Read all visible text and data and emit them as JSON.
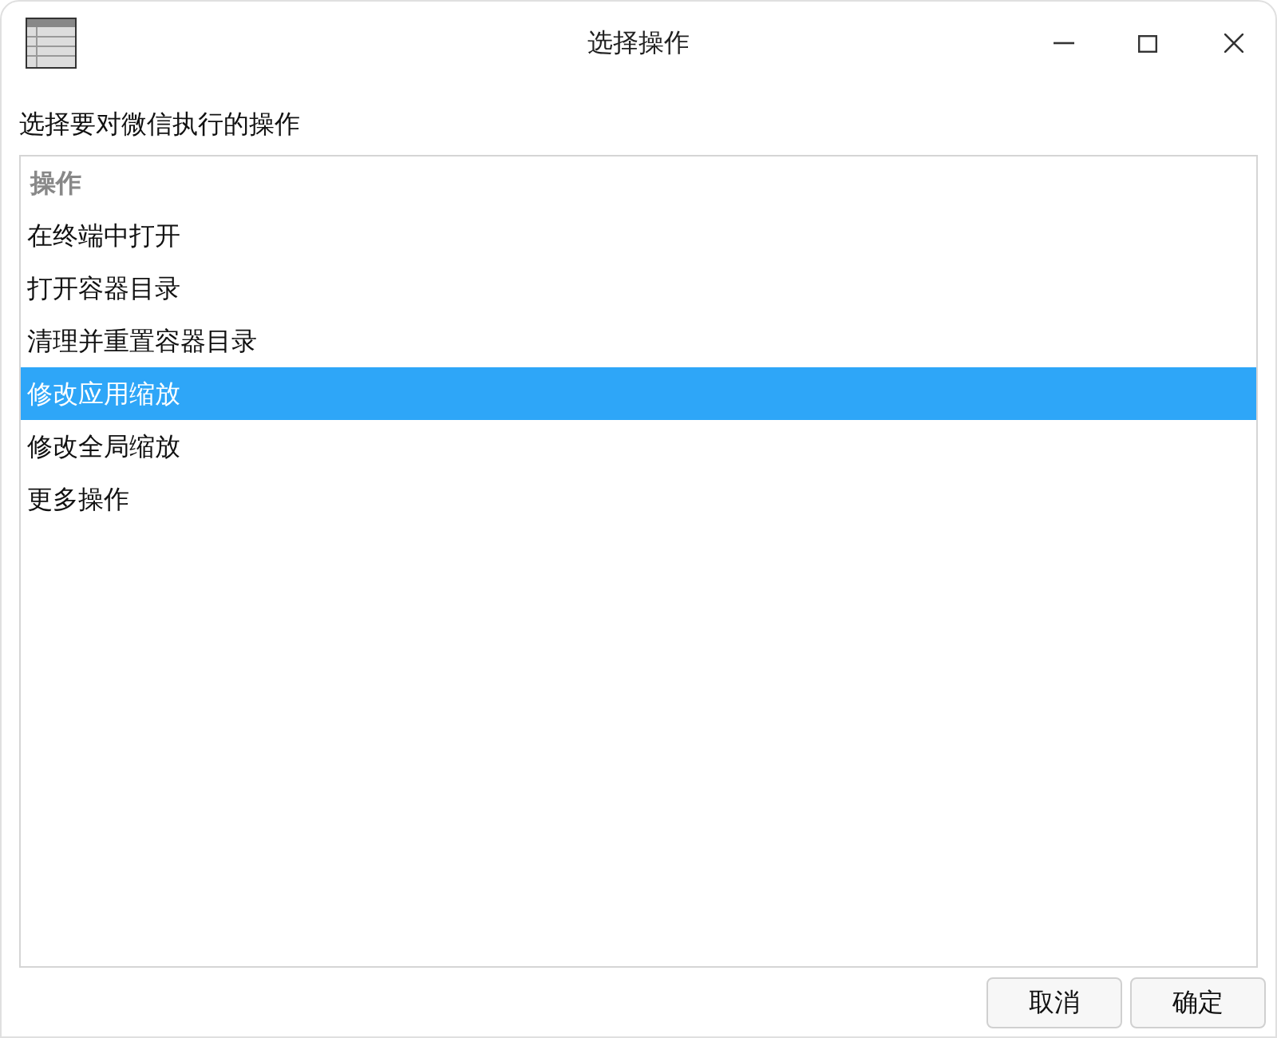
{
  "window": {
    "title": "选择操作"
  },
  "prompt": "选择要对微信执行的操作",
  "list": {
    "header": "操作",
    "items": [
      {
        "label": "在终端中打开",
        "selected": false
      },
      {
        "label": "打开容器目录",
        "selected": false
      },
      {
        "label": "清理并重置容器目录",
        "selected": false
      },
      {
        "label": "修改应用缩放",
        "selected": true
      },
      {
        "label": "修改全局缩放",
        "selected": false
      },
      {
        "label": "更多操作",
        "selected": false
      }
    ]
  },
  "buttons": [
    "取消",
    "确定"
  ]
}
